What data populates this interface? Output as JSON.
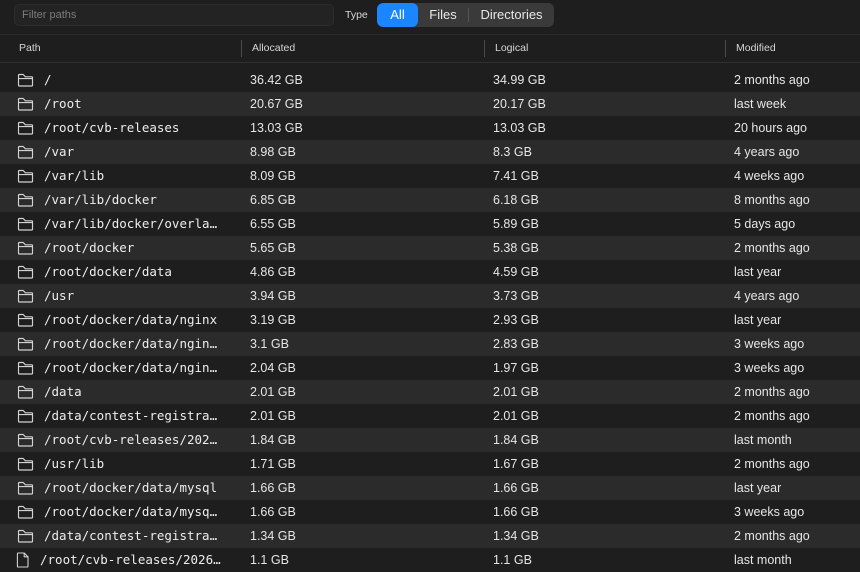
{
  "toolbar": {
    "filter_placeholder": "Filter paths",
    "type_label": "Type",
    "type_options": [
      "All",
      "Files",
      "Directories"
    ],
    "selected_type": "All",
    "accent_color": "#1a86ff"
  },
  "columns": [
    "Path",
    "Allocated",
    "Logical",
    "Modified"
  ],
  "rows": [
    {
      "kind": "folder-icon",
      "path": "/",
      "allocated": "36.42 GB",
      "logical": "34.99 GB",
      "modified": "2 months ago"
    },
    {
      "kind": "folder-icon",
      "path": "/root",
      "allocated": "20.67 GB",
      "logical": "20.17 GB",
      "modified": "last week"
    },
    {
      "kind": "folder-icon",
      "path": "/root/cvb-releases",
      "allocated": "13.03 GB",
      "logical": "13.03 GB",
      "modified": "20 hours ago"
    },
    {
      "kind": "folder-icon",
      "path": "/var",
      "allocated": "8.98 GB",
      "logical": "8.3 GB",
      "modified": "4 years ago"
    },
    {
      "kind": "folder-icon",
      "path": "/var/lib",
      "allocated": "8.09 GB",
      "logical": "7.41 GB",
      "modified": "4 weeks ago"
    },
    {
      "kind": "folder-icon",
      "path": "/var/lib/docker",
      "allocated": "6.85 GB",
      "logical": "6.18 GB",
      "modified": "8 months ago"
    },
    {
      "kind": "folder-icon",
      "path": "/var/lib/docker/overla…",
      "allocated": "6.55 GB",
      "logical": "5.89 GB",
      "modified": "5 days ago"
    },
    {
      "kind": "folder-icon",
      "path": "/root/docker",
      "allocated": "5.65 GB",
      "logical": "5.38 GB",
      "modified": "2 months ago"
    },
    {
      "kind": "folder-icon",
      "path": "/root/docker/data",
      "allocated": "4.86 GB",
      "logical": "4.59 GB",
      "modified": "last year"
    },
    {
      "kind": "folder-icon",
      "path": "/usr",
      "allocated": "3.94 GB",
      "logical": "3.73 GB",
      "modified": "4 years ago"
    },
    {
      "kind": "folder-icon",
      "path": "/root/docker/data/nginx",
      "allocated": "3.19 GB",
      "logical": "2.93 GB",
      "modified": "last year"
    },
    {
      "kind": "folder-icon",
      "path": "/root/docker/data/ngin…",
      "allocated": "3.1 GB",
      "logical": "2.83 GB",
      "modified": "3 weeks ago"
    },
    {
      "kind": "folder-icon",
      "path": "/root/docker/data/ngin…",
      "allocated": "2.04 GB",
      "logical": "1.97 GB",
      "modified": "3 weeks ago"
    },
    {
      "kind": "folder-icon",
      "path": "/data",
      "allocated": "2.01 GB",
      "logical": "2.01 GB",
      "modified": "2 months ago"
    },
    {
      "kind": "folder-icon",
      "path": "/data/contest-registra…",
      "allocated": "2.01 GB",
      "logical": "2.01 GB",
      "modified": "2 months ago"
    },
    {
      "kind": "folder-icon",
      "path": "/root/cvb-releases/202…",
      "allocated": "1.84 GB",
      "logical": "1.84 GB",
      "modified": "last month"
    },
    {
      "kind": "folder-icon",
      "path": "/usr/lib",
      "allocated": "1.71 GB",
      "logical": "1.67 GB",
      "modified": "2 months ago"
    },
    {
      "kind": "folder-icon",
      "path": "/root/docker/data/mysql",
      "allocated": "1.66 GB",
      "logical": "1.66 GB",
      "modified": "last year"
    },
    {
      "kind": "folder-icon",
      "path": "/root/docker/data/mysq…",
      "allocated": "1.66 GB",
      "logical": "1.66 GB",
      "modified": "3 weeks ago"
    },
    {
      "kind": "folder-icon",
      "path": "/data/contest-registra…",
      "allocated": "1.34 GB",
      "logical": "1.34 GB",
      "modified": "2 months ago"
    },
    {
      "kind": "file-icon",
      "path": "/root/cvb-releases/2026…",
      "allocated": "1.1 GB",
      "logical": "1.1 GB",
      "modified": "last month"
    }
  ]
}
